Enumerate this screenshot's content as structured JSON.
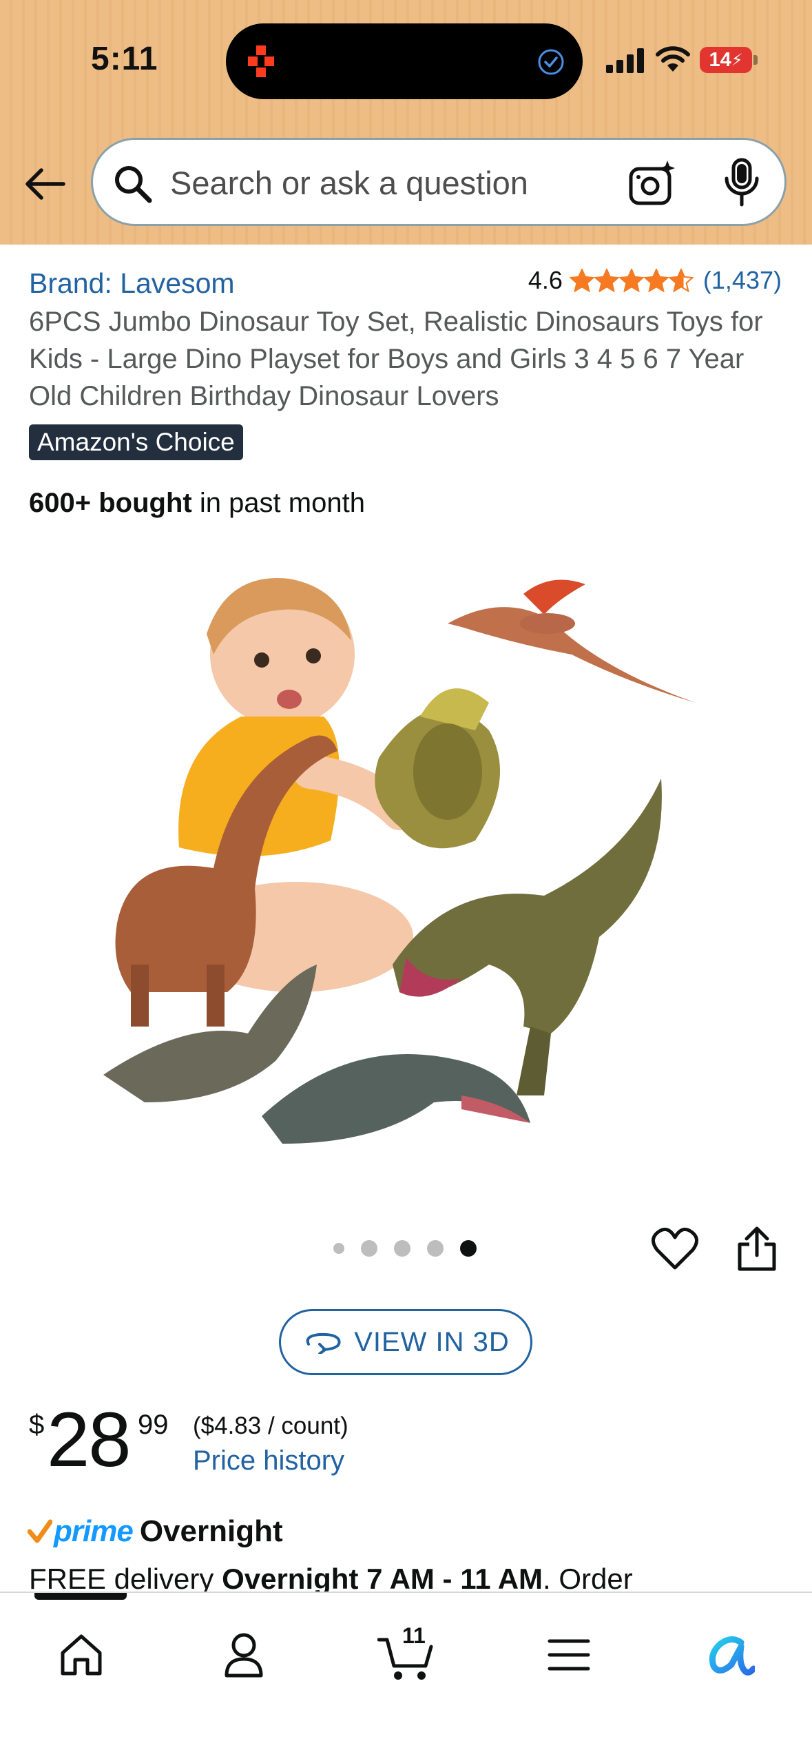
{
  "status_bar": {
    "time": "5:11",
    "battery": "14"
  },
  "search": {
    "placeholder": "Search or ask a question"
  },
  "product": {
    "brand": "Brand: Lavesom",
    "rating_value": "4.6",
    "rating_stars": 4.6,
    "rating_count": "(1,437)",
    "title": "6PCS Jumbo Dinosaur Toy Set, Realistic Dinosaurs Toys for Kids - Large Dino Playset for Boys and Girls 3 4 5 6 7 Year Old Children Birthday Dinosaur Lovers",
    "badge": "Amazon's Choice",
    "bought_bold": "600+ bought",
    "bought_rest": " in past month",
    "image_count": 5,
    "active_image": 5
  },
  "actions": {
    "view_3d": "VIEW IN 3D"
  },
  "price": {
    "symbol": "$",
    "whole": "28",
    "fraction": "99",
    "unit_price": "($4.83 / count)",
    "history_link": "Price history"
  },
  "delivery": {
    "prime": "prime",
    "speed": "Overnight",
    "line_start": "FREE delivery ",
    "line_bold": "Overnight 7 AM - 11 AM",
    "line_end": ". Order"
  },
  "bottom_nav": {
    "cart_count": "11"
  },
  "colors": {
    "header_bg": "#eebd85",
    "link": "#2162a1",
    "star": "#f57a21",
    "badge_bg": "#232f3e",
    "prime_blue": "#1399ff"
  }
}
